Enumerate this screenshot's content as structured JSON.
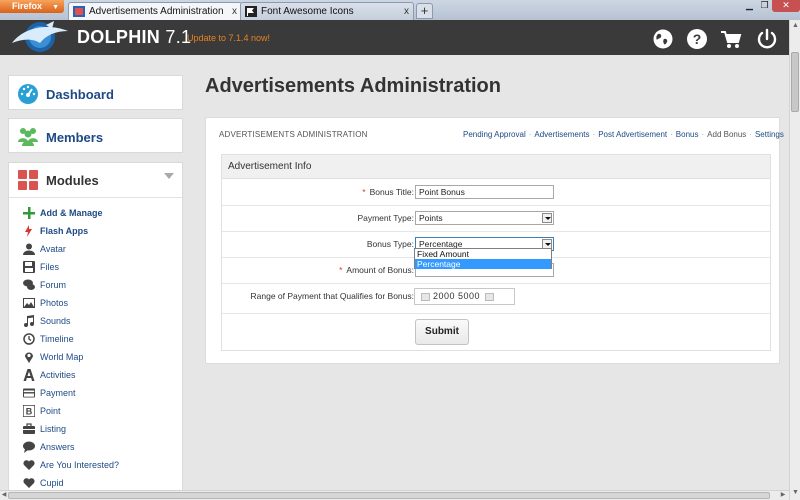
{
  "browser": {
    "menu_button": "Firefox",
    "tabs": [
      {
        "title": "Advertisements Administration",
        "active": true
      },
      {
        "title": "Font Awesome Icons",
        "active": false
      }
    ],
    "new_tab_symbol": "+",
    "tab_close_symbol": "x"
  },
  "header": {
    "brand": "DOLPHIN",
    "version": "7.1",
    "update_text": "Update to 7.1.4 now!",
    "icons": [
      "globe-icon",
      "help-icon",
      "cart-icon",
      "power-icon"
    ]
  },
  "sidebar": {
    "dashboard_label": "Dashboard",
    "members_label": "Members",
    "modules_label": "Modules",
    "modules": [
      {
        "label": "Add & Manage",
        "icon": "plus-icon",
        "bold": true
      },
      {
        "label": "Flash Apps",
        "icon": "bolt-icon",
        "bold": true
      },
      {
        "label": "Avatar",
        "icon": "user-icon"
      },
      {
        "label": "Files",
        "icon": "save-icon"
      },
      {
        "label": "Forum",
        "icon": "comments-icon"
      },
      {
        "label": "Photos",
        "icon": "picture-icon"
      },
      {
        "label": "Sounds",
        "icon": "music-icon"
      },
      {
        "label": "Timeline",
        "icon": "clock-icon"
      },
      {
        "label": "World Map",
        "icon": "map-marker-icon"
      },
      {
        "label": "Activities",
        "icon": "font-icon"
      },
      {
        "label": "Payment",
        "icon": "credit-card-icon"
      },
      {
        "label": "Point",
        "icon": "bitcoin-icon"
      },
      {
        "label": "Listing",
        "icon": "briefcase-icon"
      },
      {
        "label": "Answers",
        "icon": "comment-icon"
      },
      {
        "label": "Are You Interested?",
        "icon": "heart-icon"
      },
      {
        "label": "Cupid",
        "icon": "heart-icon"
      }
    ]
  },
  "main": {
    "page_title": "Advertisements Administration",
    "breadcrumb": "ADVERTISEMENTS ADMINISTRATION",
    "tabs": [
      "Pending Approval",
      "Advertisements",
      "Post Advertisement",
      "Bonus",
      "Add Bonus",
      "Settings"
    ],
    "current_tab": "Add Bonus",
    "form": {
      "section_title": "Advertisement Info",
      "bonus_title_label": "Bonus Title:",
      "bonus_title_value": "Point Bonus",
      "payment_type_label": "Payment Type:",
      "payment_type_value": "Points",
      "bonus_type_label": "Bonus Type:",
      "bonus_type_value": "Percentage",
      "bonus_type_options": [
        "Fixed Amount",
        "Percentage"
      ],
      "amount_label": "Amount of Bonus:",
      "range_label": "Range of Payment that Qualifies for Bonus:",
      "range_value": "2000 5000",
      "submit_label": "Submit",
      "required_mark": "*"
    }
  },
  "colors": {
    "header_bg": "#3a3a3a",
    "link_blue": "#1d4a85",
    "update_orange": "#e8831f",
    "required_red": "#d9372d",
    "dashboard_icon": "#2a9fd6",
    "members_icon": "#5cb85c",
    "modules_icon": "#d9534f",
    "highlight_blue": "#3399ff"
  }
}
